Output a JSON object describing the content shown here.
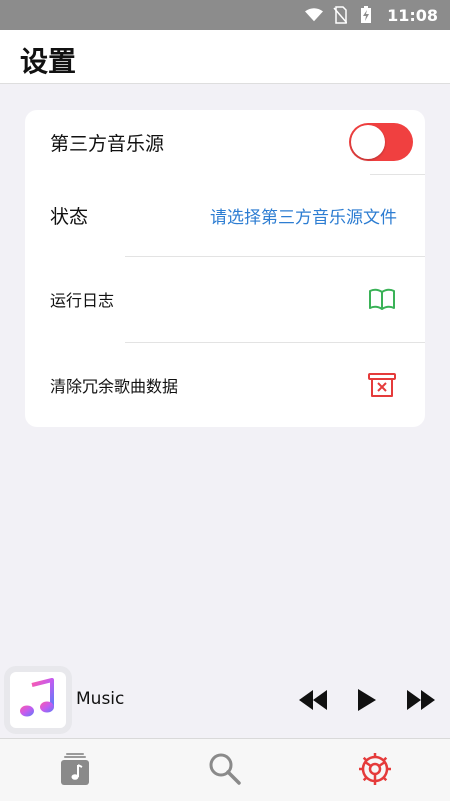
{
  "status_bar": {
    "time": "11:08"
  },
  "header": {
    "title": "设置"
  },
  "settings": {
    "third_party_source": {
      "label": "第三方音乐源",
      "enabled": true
    },
    "status": {
      "label": "状态",
      "value": "请选择第三方音乐源文件"
    },
    "run_log": {
      "label": "运行日志",
      "icon": "book-icon"
    },
    "clean_data": {
      "label": "清除冗余歌曲数据",
      "icon": "trash-x-icon"
    }
  },
  "player": {
    "track_title": "Music"
  },
  "tabbar": {
    "tabs": [
      {
        "icon": "music-library-icon"
      },
      {
        "icon": "search-icon"
      },
      {
        "icon": "settings-gear-icon",
        "active": true
      }
    ]
  },
  "colors": {
    "accent_red": "#e53b3b",
    "link_blue": "#2d7dd2",
    "log_green": "#3ab257"
  }
}
